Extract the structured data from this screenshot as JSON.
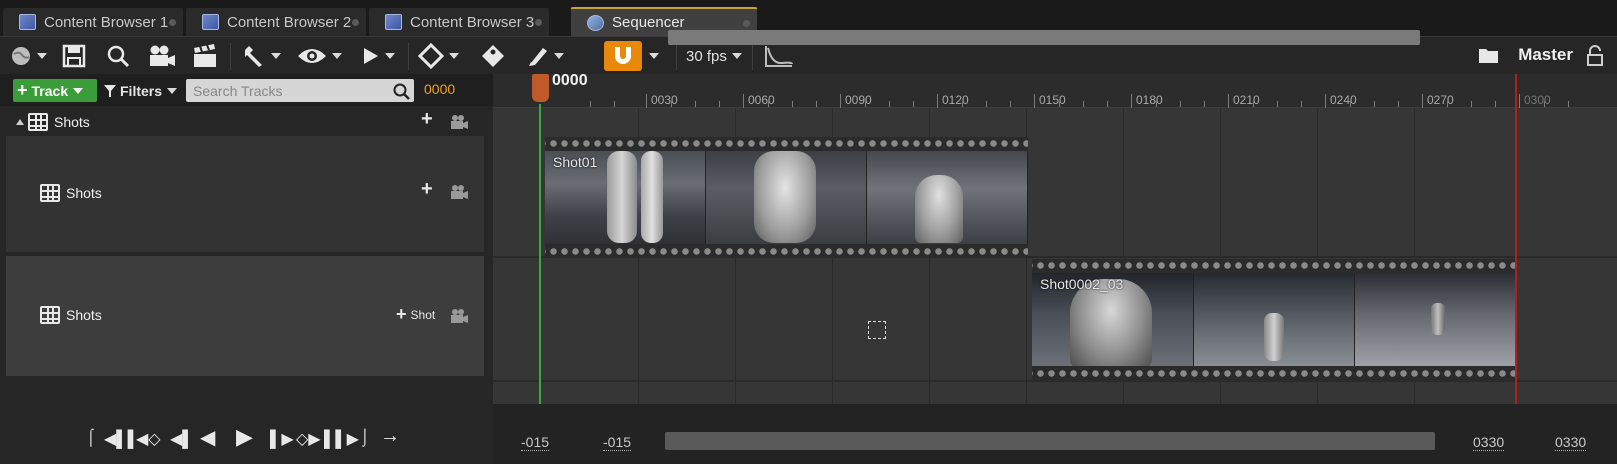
{
  "tabs": [
    {
      "label": "Content Browser 1",
      "active": false
    },
    {
      "label": "Content Browser 2",
      "active": false
    },
    {
      "label": "Content Browser 3",
      "active": false
    },
    {
      "label": "Sequencer",
      "active": true
    }
  ],
  "toolbar": {
    "fps_label": "30 fps",
    "master_label": "Master",
    "snap_color": "#e8890c",
    "icons": [
      "world-icon",
      "save-icon",
      "search-icon",
      "camera-icon",
      "clapper-icon",
      "wrench-icon",
      "eye-icon",
      "play-icon",
      "keyframe-icon",
      "key-tag-icon",
      "brush-icon",
      "snap-magnet-icon",
      "curve-editor-icon",
      "folder-icon",
      "lock-icon"
    ]
  },
  "left_header": {
    "track_button": "Track",
    "filters_button": "Filters",
    "search_placeholder": "Search Tracks",
    "current_frame": "0000"
  },
  "tracks": {
    "root_label": "Shots",
    "row1_label": "Shots",
    "row2_label": "Shots",
    "row2_add_label": "Shot"
  },
  "ruler": {
    "current_time": "0000",
    "ticks": [
      "0030",
      "0060",
      "0090",
      "0120",
      "0150",
      "0180",
      "0210",
      "0240",
      "0270",
      "0300"
    ]
  },
  "sections": [
    {
      "name": "Shot01"
    },
    {
      "name": "Shot0002_03"
    }
  ],
  "range": {
    "start_outer": "-015",
    "start_inner": "-015",
    "end_inner": "0330",
    "end_outer": "0330"
  },
  "colors": {
    "playhead": "#c05a2a",
    "playhead_line": "#3ca83c",
    "end_marker": "#b02020",
    "time_field": "#f0a020",
    "add_track": "#3a9d3a"
  }
}
